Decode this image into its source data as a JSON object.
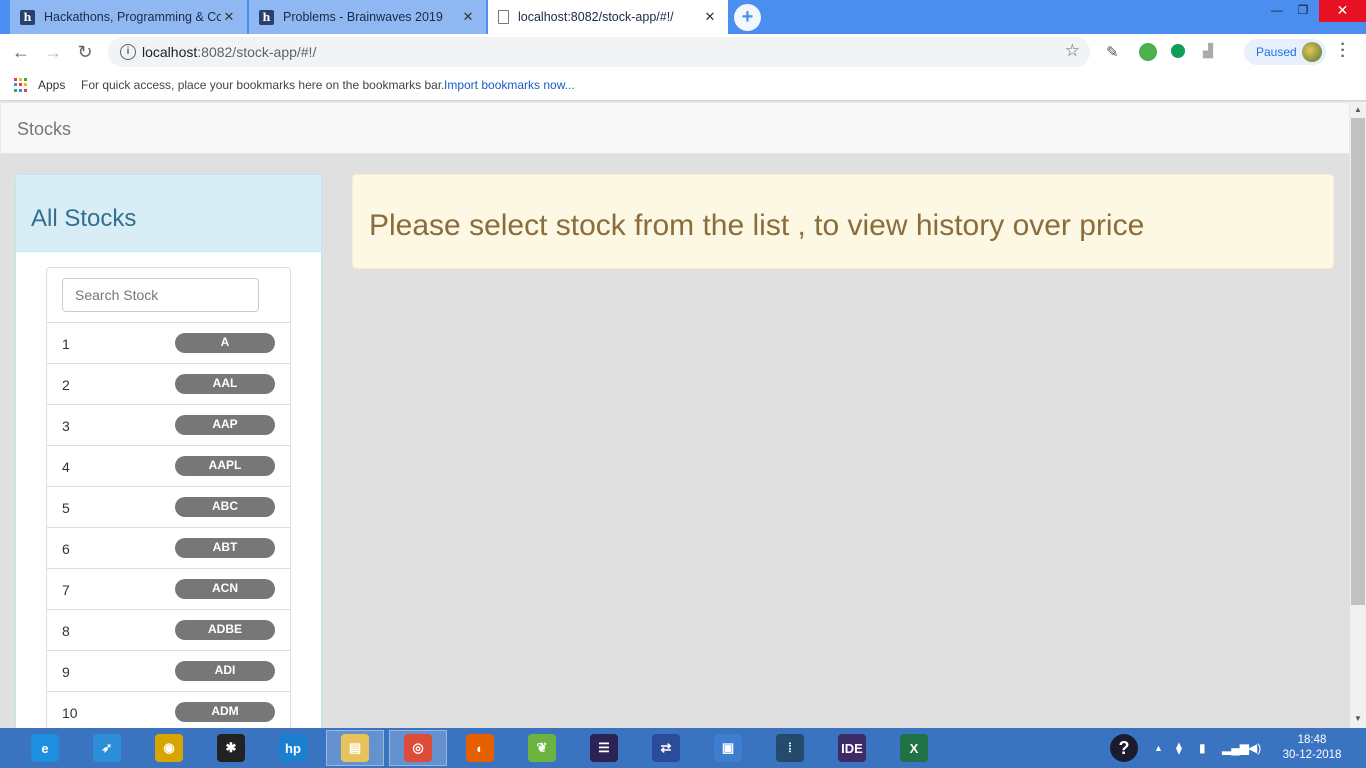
{
  "browser": {
    "tabs": [
      {
        "title": "Hackathons, Programming & Co",
        "active": false,
        "favicon": "h-icon"
      },
      {
        "title": "Problems - Brainwaves 2019",
        "active": false,
        "favicon": "h-icon"
      },
      {
        "title": "localhost:8082/stock-app/#!/",
        "active": true,
        "favicon": "page-icon"
      }
    ],
    "new_tab": "+",
    "url_host": "localhost",
    "url_rest": ":8082/stock-app/#!/",
    "profile_status": "Paused",
    "bookmarks": {
      "apps_label": "Apps",
      "hint": "For quick access, place your bookmarks here on the bookmarks bar.",
      "import_link": "Import bookmarks now..."
    }
  },
  "app": {
    "brand": "Stocks",
    "panel_title": "All Stocks",
    "search_placeholder": "Search Stock",
    "stocks": [
      {
        "num": "1",
        "symbol": "A"
      },
      {
        "num": "2",
        "symbol": "AAL"
      },
      {
        "num": "3",
        "symbol": "AAP"
      },
      {
        "num": "4",
        "symbol": "AAPL"
      },
      {
        "num": "5",
        "symbol": "ABC"
      },
      {
        "num": "6",
        "symbol": "ABT"
      },
      {
        "num": "7",
        "symbol": "ACN"
      },
      {
        "num": "8",
        "symbol": "ADBE"
      },
      {
        "num": "9",
        "symbol": "ADI"
      },
      {
        "num": "10",
        "symbol": "ADM"
      }
    ],
    "alert_message": "Please select stock from the list , to view history over price"
  },
  "taskbar": {
    "apps": [
      {
        "name": "internet-explorer-icon",
        "color": "#1e8fe0",
        "glyph": "e"
      },
      {
        "name": "rocket-app-icon",
        "color": "#2a8fd8",
        "glyph": "➶"
      },
      {
        "name": "media-player-icon",
        "color": "#d8a400",
        "glyph": "◉"
      },
      {
        "name": "puzzle-app-icon",
        "color": "#222222",
        "glyph": "✱"
      },
      {
        "name": "hp-icon",
        "color": "#1a7fcf",
        "glyph": "hp"
      },
      {
        "name": "file-explorer-icon",
        "color": "#e8c25a",
        "glyph": "▤"
      },
      {
        "name": "chrome-icon",
        "color": "#dd4b39",
        "glyph": "◎"
      },
      {
        "name": "firefox-icon",
        "color": "#e66000",
        "glyph": "◐"
      },
      {
        "name": "spring-tool-icon",
        "color": "#6db33f",
        "glyph": "❦"
      },
      {
        "name": "eclipse-icon",
        "color": "#2c2255",
        "glyph": "☰"
      },
      {
        "name": "network-config-icon",
        "color": "#2b4c9a",
        "glyph": "⇄"
      },
      {
        "name": "device-connect-icon",
        "color": "#3d7ecf",
        "glyph": "▣"
      },
      {
        "name": "mysql-workbench-icon",
        "color": "#244b6e",
        "glyph": "⦙"
      },
      {
        "name": "java-ee-ide-icon",
        "color": "#3c2b66",
        "glyph": "IDE"
      },
      {
        "name": "excel-icon",
        "color": "#1f7244",
        "glyph": "X"
      }
    ],
    "help_glyph": "?",
    "time": "18:48",
    "date": "30-12-2018"
  },
  "colors": {
    "tabstrip": "#4a8ef0",
    "panel_heading": "#d9edf7",
    "panel_title": "#31708f",
    "alert_bg": "#fcf8e3",
    "alert_text": "#8a6d3b",
    "badge": "#777777",
    "taskbar": "#3a74c0"
  }
}
